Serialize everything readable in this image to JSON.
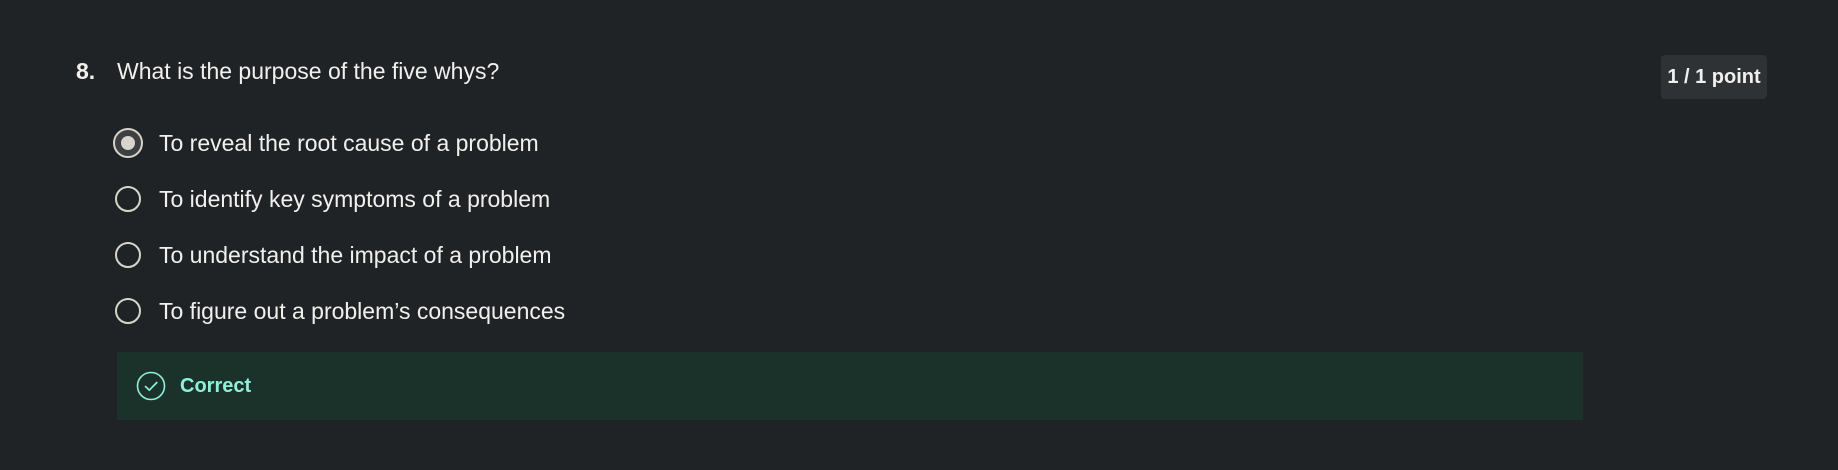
{
  "question": {
    "number": "8.",
    "text": "What is the purpose of the five whys?",
    "points": "1 / 1 point"
  },
  "options": [
    {
      "label": "To reveal the root cause of a problem",
      "selected": true
    },
    {
      "label": "To identify key symptoms of a problem",
      "selected": false
    },
    {
      "label": "To understand the impact of a problem",
      "selected": false
    },
    {
      "label": "To figure out a problem’s consequences",
      "selected": false
    }
  ],
  "feedback": {
    "status": "Correct",
    "icon": "check-circle-icon",
    "color": "#8ff0d8",
    "background": "#1b322b"
  }
}
